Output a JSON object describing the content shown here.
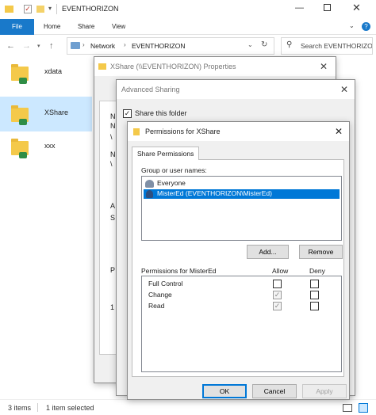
{
  "explorer": {
    "title": "EVENTHORIZON",
    "tabs": [
      "File",
      "Home",
      "Share",
      "View"
    ],
    "breadcrumb": [
      "Network",
      "EVENTHORIZON"
    ],
    "search_placeholder": "Search EVENTHORIZON",
    "items": [
      {
        "name": "xdata"
      },
      {
        "name": "XShare",
        "selected": true
      },
      {
        "name": "xxx"
      }
    ],
    "status": {
      "count": "3 items",
      "selected": "1 item selected"
    }
  },
  "properties_dialog": {
    "title": "XShare (\\\\EVENTHORIZON) Properties",
    "left_edge_letters": [
      "N",
      "A",
      "S",
      "P",
      "1"
    ]
  },
  "advanced_sharing": {
    "title": "Advanced Sharing",
    "share_checkbox_label": "Share this folder",
    "share_checked": true
  },
  "permissions": {
    "title": "Permissions for XShare",
    "tab": "Share Permissions",
    "group_label": "Group or user names:",
    "users": [
      {
        "name": "Everyone",
        "selected": false
      },
      {
        "name": "MisterEd (EVENTHORIZON\\MisterEd)",
        "selected": true
      }
    ],
    "add_button": "Add...",
    "remove_button": "Remove",
    "perm_label": "Permissions for MisterEd",
    "allow_header": "Allow",
    "deny_header": "Deny",
    "perms": [
      {
        "name": "Full Control",
        "allow": false,
        "deny": false
      },
      {
        "name": "Change",
        "allow": true,
        "deny": false
      },
      {
        "name": "Read",
        "allow": true,
        "deny": false
      }
    ],
    "ok": "OK",
    "cancel": "Cancel",
    "apply": "Apply"
  },
  "colors": {
    "accent": "#1979ca",
    "selection": "#0078d7"
  }
}
